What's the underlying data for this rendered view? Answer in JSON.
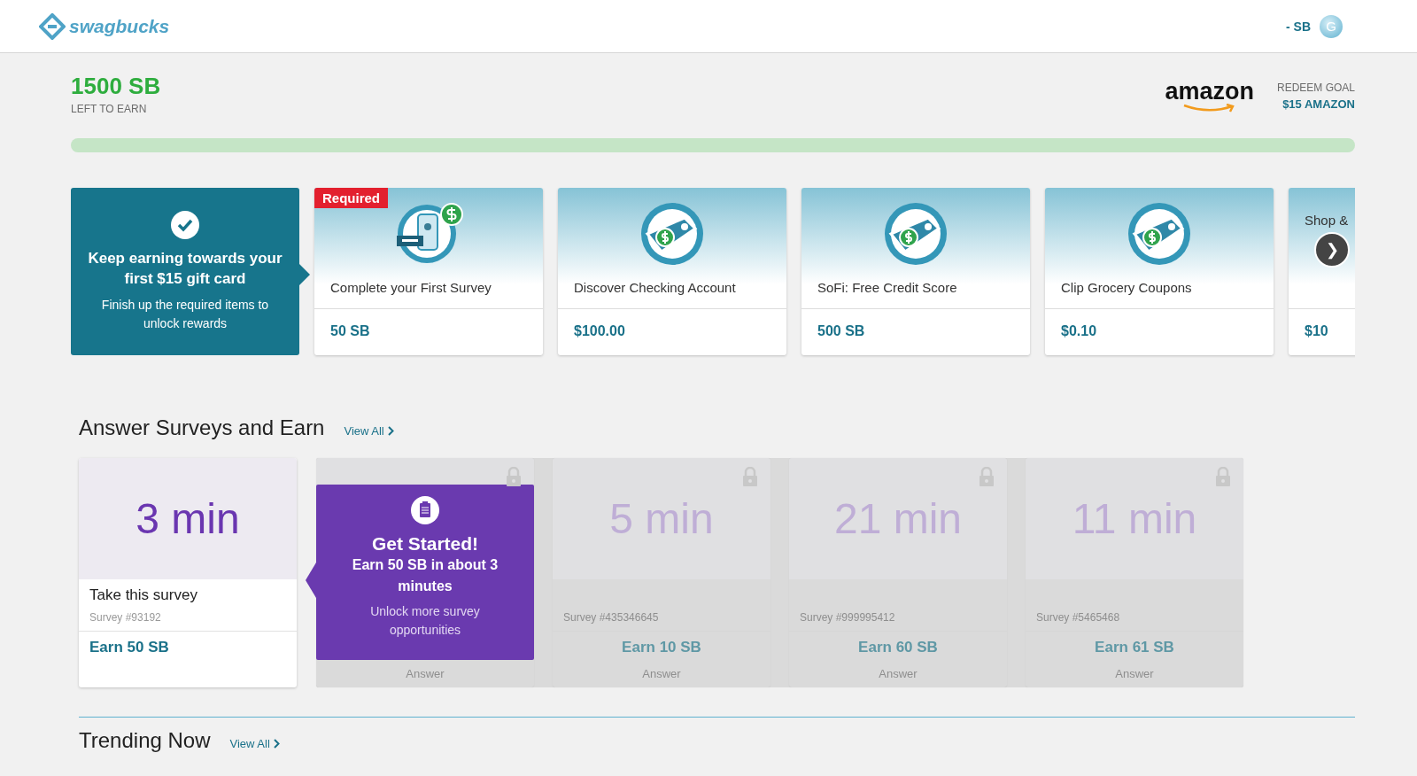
{
  "header": {
    "logo": "swagbucks",
    "balance": "- SB",
    "avatar": "G"
  },
  "goal": {
    "amount": "1500 SB",
    "caption": "LEFT TO EARN",
    "brand": "amazon",
    "goal_label": "REDEEM GOAL",
    "goal_value": "$15 AMAZON",
    "level": 0
  },
  "intro": {
    "title": "Keep earning towards your first $15 gift card",
    "body": "Finish up the required items to unlock rewards"
  },
  "offers": [
    {
      "kind": "survey",
      "title": "Complete your First Survey",
      "reward": "50 SB",
      "required": true
    },
    {
      "kind": "tag",
      "title": "Discover Checking Account",
      "reward": "$100.00",
      "required": false
    },
    {
      "kind": "tag",
      "title": "SoFi: Free Credit Score",
      "reward": "500 SB",
      "required": false
    },
    {
      "kind": "tag",
      "title": "Clip Grocery Coupons",
      "reward": "$0.10",
      "required": false
    },
    {
      "kind": "none",
      "title": "Shop &",
      "reward": "$10",
      "required": false
    }
  ],
  "required_badge": "Required",
  "next_arrow": "❯",
  "surveys_section": {
    "title": "Answer Surveys and Earn",
    "view_all": "View All"
  },
  "surveys": [
    {
      "time": "3 min",
      "action": "Take this survey",
      "number": "Survey #93192",
      "earn": "Earn 50 SB",
      "locked": false
    },
    {
      "answer": "Answer",
      "locked": true
    },
    {
      "time": "5 min",
      "number": "Survey #435346645",
      "earn": "Earn 10 SB",
      "answer": "Answer",
      "locked": true
    },
    {
      "time": "21 min",
      "number": "Survey #999995412",
      "earn": "Earn 60 SB",
      "answer": "Answer",
      "locked": true
    },
    {
      "time": "11 min",
      "number": "Survey #5465468",
      "earn": "Earn 61 SB",
      "answer": "Answer",
      "locked": true
    }
  ],
  "popup": {
    "title": "Get Started!",
    "subtitle": "Earn 50 SB in about 3 minutes",
    "body": "Unlock more survey opportunities"
  },
  "trending_section": {
    "title": "Trending Now",
    "view_all": "View All"
  }
}
